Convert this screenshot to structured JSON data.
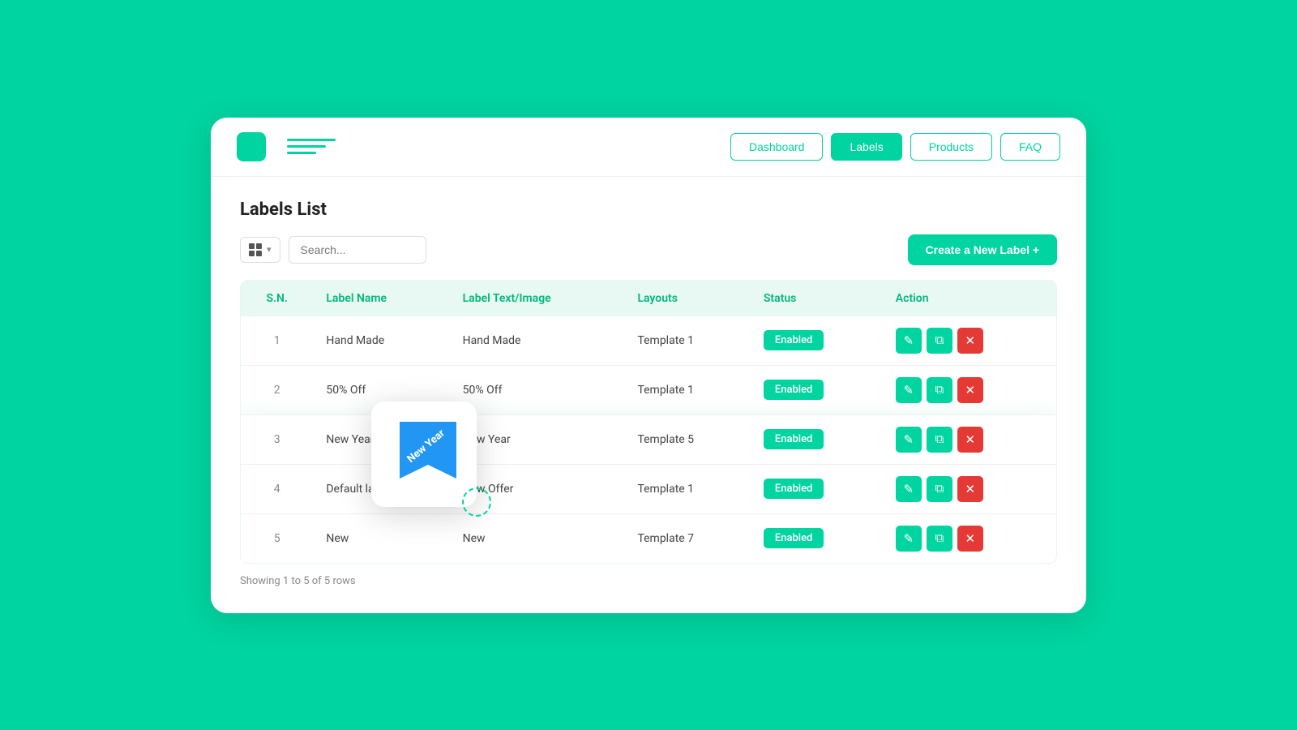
{
  "header": {
    "logo_alt": "Logo",
    "nav": {
      "dashboard": "Dashboard",
      "labels": "Labels",
      "products": "Products",
      "faq": "FAQ"
    }
  },
  "page": {
    "title": "Labels List",
    "search_placeholder": "Search...",
    "create_button": "Create a New Label +",
    "showing_text": "Showing 1 to 5 of 5 rows"
  },
  "table": {
    "columns": [
      "S.N.",
      "Label Name",
      "Label Text/Image",
      "Layouts",
      "Status",
      "Action"
    ],
    "rows": [
      {
        "sn": "1",
        "label_name": "Hand Made",
        "label_text": "Hand Made",
        "layout": "Template 1",
        "status": "Enabled"
      },
      {
        "sn": "2",
        "label_name": "50% Off",
        "label_text": "50% Off",
        "layout": "Template 1",
        "status": "Enabled"
      },
      {
        "sn": "3",
        "label_name": "New Year",
        "label_text": "New Year",
        "layout": "Template 5",
        "status": "Enabled",
        "highlighted": true
      },
      {
        "sn": "4",
        "label_name": "Default label",
        "label_text": "New  Offer",
        "layout": "Template 1",
        "status": "Enabled"
      },
      {
        "sn": "5",
        "label_name": "New",
        "label_text": "New",
        "layout": "Template 7",
        "status": "Enabled"
      }
    ]
  },
  "label_preview": {
    "text": "New Year",
    "bg_color": "#2196F3"
  },
  "icons": {
    "edit": "✎",
    "copy": "⧉",
    "delete": "✕",
    "grid": "▦",
    "chevron": "▾"
  }
}
